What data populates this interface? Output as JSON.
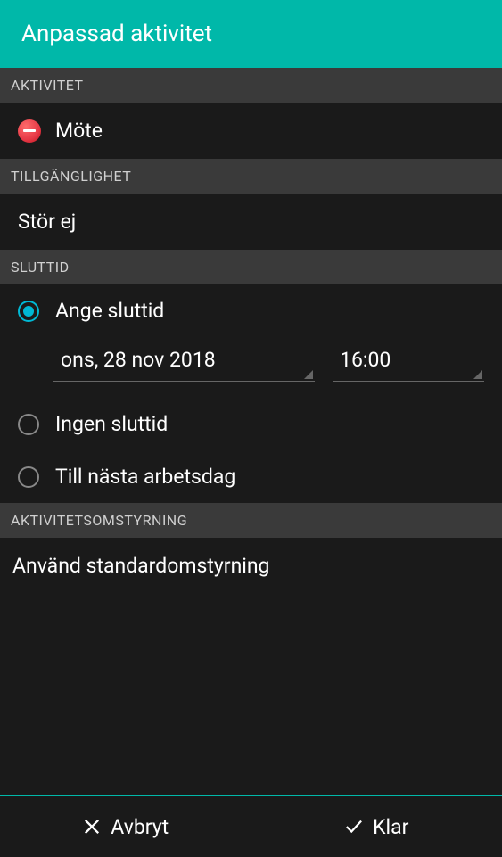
{
  "header": {
    "title": "Anpassad aktivitet"
  },
  "sections": {
    "activity": {
      "header": "AKTIVITET",
      "value": "Möte"
    },
    "availability": {
      "header": "TILLGÄNGLIGHET",
      "value": "Stör ej"
    },
    "endTime": {
      "header": "SLUTTID",
      "options": {
        "setEnd": "Ange sluttid",
        "noEnd": "Ingen sluttid",
        "nextWorkday": "Till nästa arbetsdag"
      },
      "date": "ons, 28 nov 2018",
      "time": "16:00"
    },
    "forwarding": {
      "header": "AKTIVITETSOMSTYRNING",
      "value": "Använd standardomstyrning"
    }
  },
  "footer": {
    "cancel": "Avbryt",
    "done": "Klar"
  }
}
